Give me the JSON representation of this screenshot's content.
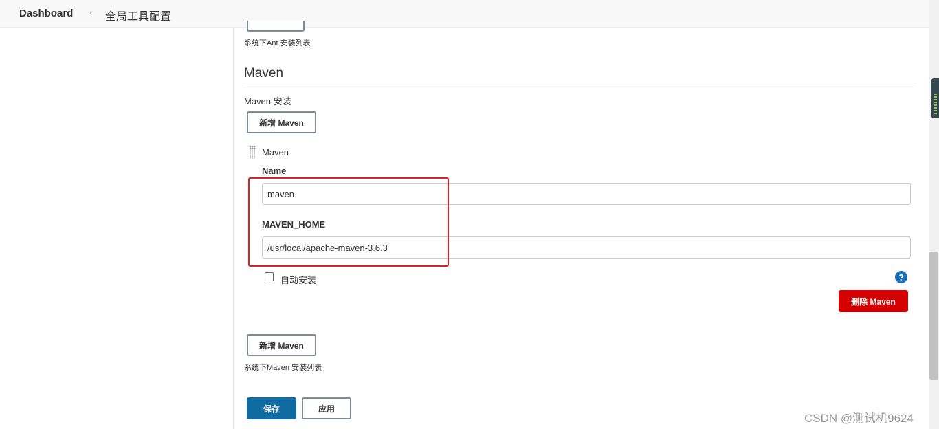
{
  "breadcrumb": {
    "home": "Dashboard",
    "separator": "›",
    "current": "全局工具配置"
  },
  "ant": {
    "footnote": "系统下Ant 安装列表"
  },
  "maven": {
    "section_title": "Maven",
    "install_label": "Maven 安装",
    "add_button": "新增 Maven",
    "entry": {
      "header": "Maven",
      "name_label": "Name",
      "name_value": "maven",
      "home_label": "MAVEN_HOME",
      "home_value": "/usr/local/apache-maven-3.6.3",
      "auto_install_label": "自动安装",
      "auto_install_checked": false,
      "help_glyph": "?",
      "delete_button": "删除 Maven"
    },
    "add_button_bottom": "新增 Maven",
    "footnote": "系统下Maven 安装列表"
  },
  "actions": {
    "save": "保存",
    "apply": "应用"
  },
  "watermark": "CSDN @测试机9624",
  "colors": {
    "primary": "#106ba3",
    "danger": "#d50000",
    "highlight": "#e02020"
  },
  "icons": {
    "help": "help-icon",
    "drag_handle": "drag-handle-icon"
  }
}
